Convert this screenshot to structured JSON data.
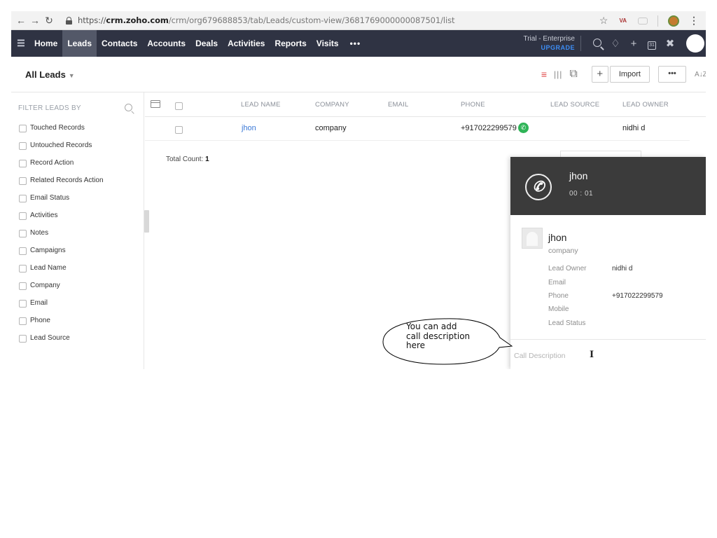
{
  "browser": {
    "url_scheme": "https://",
    "url_host": "crm.zoho.com",
    "url_path": "/crm/org679688853/tab/Leads/custom-view/3681769000000087501/list",
    "back_icon": "arrow-left-icon",
    "forward_icon": "arrow-right-icon",
    "reload_icon": "reload-icon",
    "extension_label": "VA"
  },
  "app_nav": {
    "items": [
      {
        "label": "Home",
        "active": false
      },
      {
        "label": "Leads",
        "active": true
      },
      {
        "label": "Contacts",
        "active": false
      },
      {
        "label": "Accounts",
        "active": false
      },
      {
        "label": "Deals",
        "active": false
      },
      {
        "label": "Activities",
        "active": false
      },
      {
        "label": "Reports",
        "active": false
      },
      {
        "label": "Visits",
        "active": false
      }
    ],
    "more_label": "•••",
    "trial_label": "Trial - Enterprise",
    "upgrade_label": "UPGRADE",
    "colors": {
      "bar": "#2f3343",
      "active": "#535868",
      "upgrade": "#3d8df5"
    }
  },
  "subheader": {
    "view_title": "All Leads",
    "caret": "⌄",
    "plus_label": "+",
    "import_label": "Import",
    "more_label": "•••",
    "sort_label": "A↓Z"
  },
  "sidebar": {
    "heading": "FILTER LEADS BY",
    "filters": [
      "Touched Records",
      "Untouched Records",
      "Record Action",
      "Related Records Action",
      "Email Status",
      "Activities",
      "Notes",
      "Campaigns",
      "Lead Name",
      "Company",
      "Email",
      "Phone",
      "Lead Source"
    ]
  },
  "table": {
    "columns": [
      "LEAD NAME",
      "COMPANY",
      "EMAIL",
      "PHONE",
      "LEAD SOURCE",
      "LEAD OWNER"
    ],
    "rows": [
      {
        "lead_name": "jhon",
        "company": "company",
        "email": "",
        "phone": "+917022299579",
        "lead_source": "",
        "lead_owner": "nidhi d"
      }
    ],
    "total_label": "Total Count:",
    "total_value": "1"
  },
  "call_panel": {
    "caller_name": "jhon",
    "timer": "00 : 01",
    "contact_name": "jhon",
    "contact_company": "company",
    "fields": [
      {
        "label": "Lead Owner",
        "value": "nidhi d"
      },
      {
        "label": "Email",
        "value": ""
      },
      {
        "label": "Phone",
        "value": "+917022299579"
      },
      {
        "label": "Mobile",
        "value": ""
      },
      {
        "label": "Lead Status",
        "value": ""
      }
    ],
    "description_placeholder": "Call Description",
    "colors": {
      "header": "#3b3b3b",
      "call_badge": "#2fb457"
    }
  },
  "callout": {
    "lines": [
      "You can add",
      "call description",
      "here"
    ]
  }
}
